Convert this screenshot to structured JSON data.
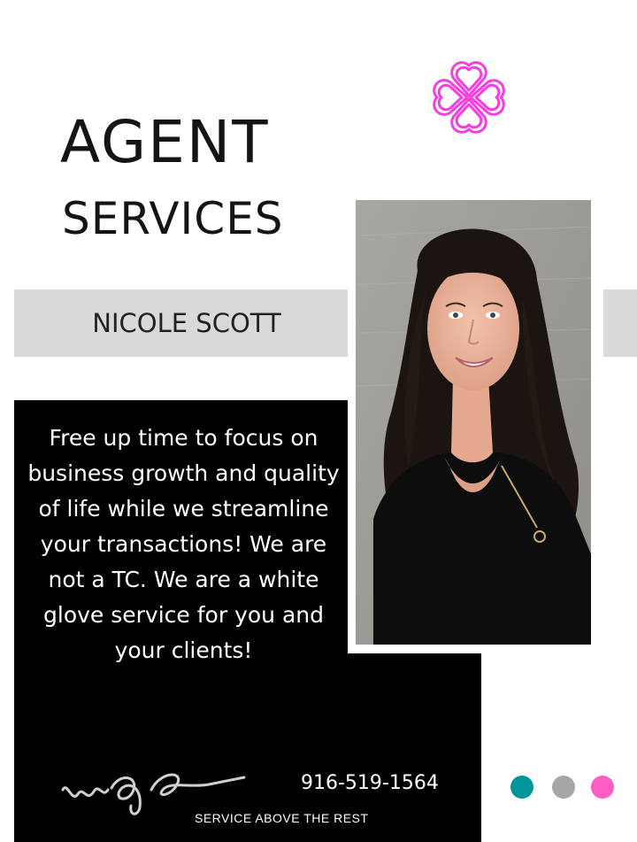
{
  "header": {
    "title_line_1": "AGENT",
    "title_line_2": "SERVICES"
  },
  "agent": {
    "name": "NICOLE SCOTT"
  },
  "promo": {
    "tagline": "Free up time to focus on business growth and quality of life while we streamline your transactions! We are not a TC. We are a white glove service for you and your clients!"
  },
  "footer": {
    "logo_text": "wge",
    "phone": "916-519-1564",
    "slogan": "SERVICE ABOVE THE REST"
  },
  "colors": {
    "logo_magenta": "#f53de0",
    "band_gray": "#d9d9d9",
    "panel_black": "#000000",
    "dot_teal": "#00949b",
    "dot_gray": "#a6a6a6",
    "dot_pink": "#ff5cc6"
  },
  "icons": {
    "logo": "interlaced-heart-knot-icon",
    "dots": [
      "teal-dot",
      "gray-dot",
      "pink-dot"
    ]
  }
}
